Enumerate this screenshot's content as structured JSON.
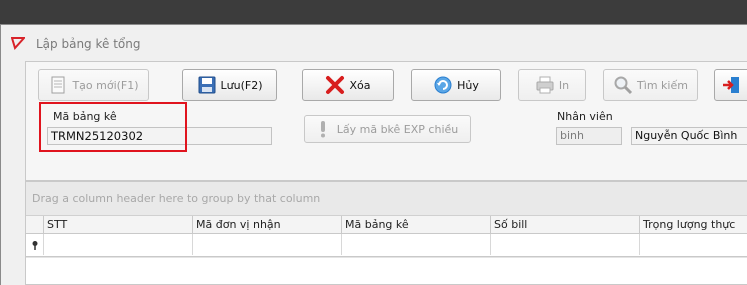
{
  "window": {
    "title": "Lập bảng kê tổng"
  },
  "toolbar": {
    "new_label": "Tạo mới(F1)",
    "save_label": "Lưu(F2)",
    "delete_label": "Xóa",
    "cancel_label": "Hủy",
    "print_label": "In",
    "search_label": "Tìm kiếm"
  },
  "form": {
    "code_label": "Mã bảng kê",
    "code_value": "TRMN25120302",
    "get_exp_label": "Lấy mã bkê EXP chiều",
    "staff_label": "Nhân viên",
    "staff_id": "binh",
    "staff_name": "Nguyễn Quốc Bình"
  },
  "grid": {
    "group_hint": "Drag a column header here to group by that column",
    "columns": [
      "STT",
      "Mã đơn vị nhận",
      "Mã bảng kê",
      "Số bill",
      "Trọng lượng thực"
    ]
  },
  "colors": {
    "highlight": "#e0141e",
    "delete_red": "#d81e1e",
    "refresh_blue": "#2a7fd0"
  }
}
